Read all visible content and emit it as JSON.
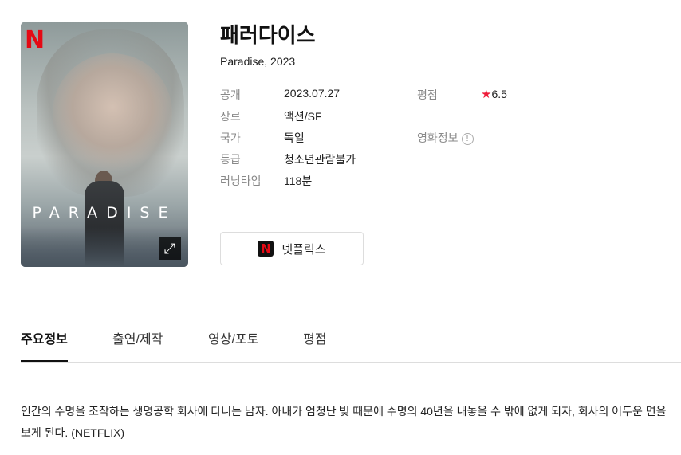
{
  "poster": {
    "brand": "N",
    "title": "PARADISE",
    "expand_icon": "expand-icon"
  },
  "movie": {
    "title": "패러다이스",
    "original": "Paradise, 2023"
  },
  "meta": {
    "release_label": "공개",
    "release_value": "2023.07.27",
    "genre_label": "장르",
    "genre_value": "액션/SF",
    "country_label": "국가",
    "country_value": "독일",
    "rating_label": "등급",
    "rating_value": "청소년관람불가",
    "runtime_label": "러닝타임",
    "runtime_value": "118분",
    "score_label": "평점",
    "score_value": "6.5",
    "movieinfo_label": "영화정보"
  },
  "watch": {
    "badge": "N",
    "label": "넷플릭스"
  },
  "tabs": [
    "주요정보",
    "출연/제작",
    "영상/포토",
    "평점"
  ],
  "synopsis": "인간의 수명을 조작하는 생명공학 회사에 다니는 남자. 아내가 엄청난 빚 때문에 수명의 40년을 내놓을 수 밖에 없게 되자, 회사의 어두운 면을 보게 된다. (NETFLIX)",
  "colors": {
    "accent": "#e50914",
    "star": "#ee1c3a"
  }
}
